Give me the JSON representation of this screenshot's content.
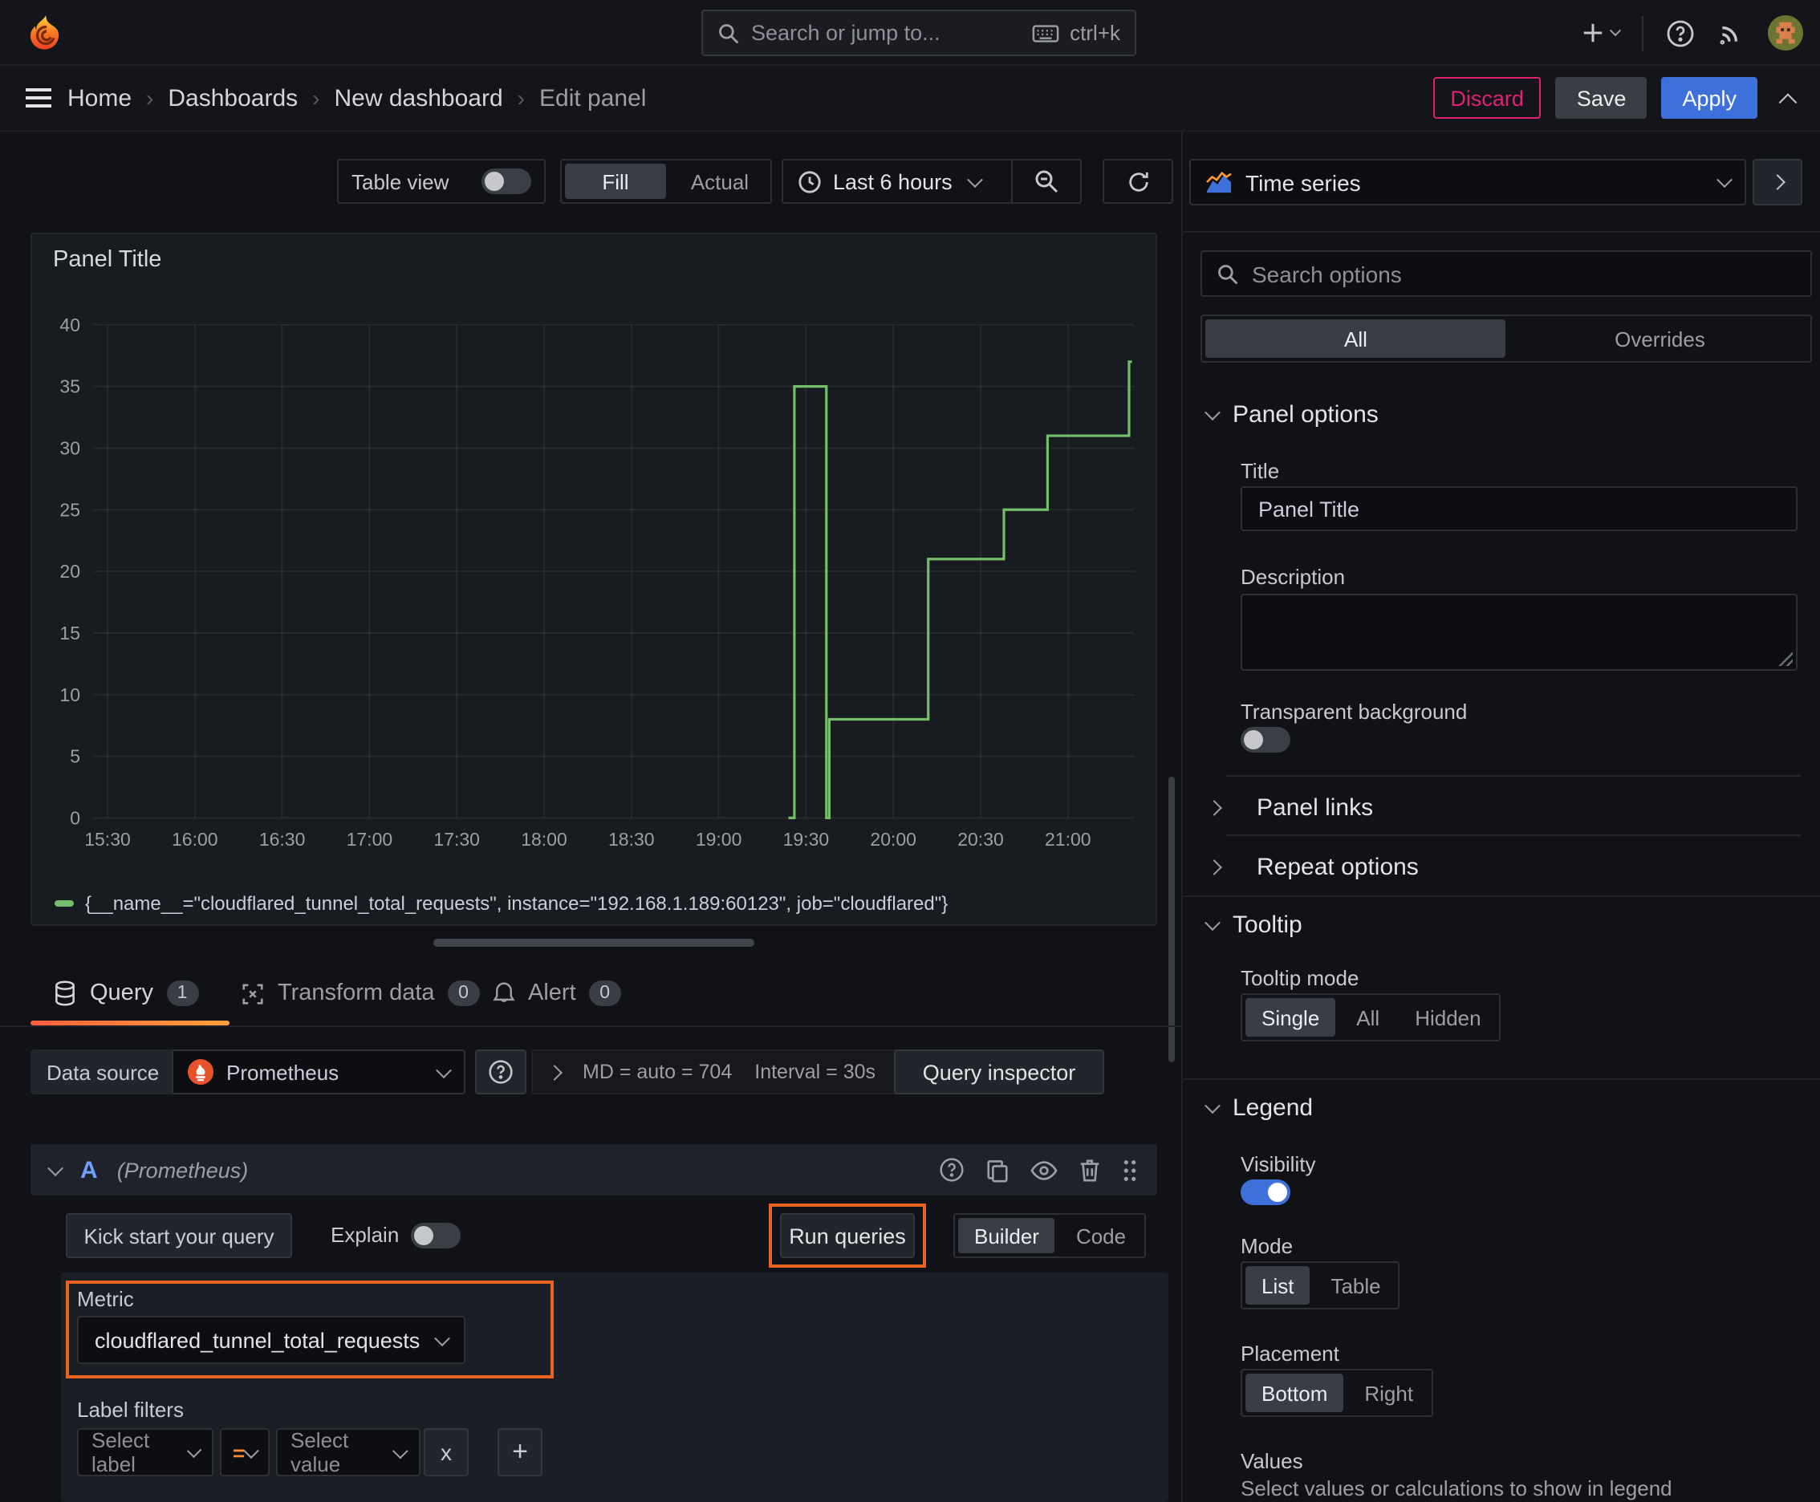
{
  "topbar": {
    "search_placeholder": "Search or jump to...",
    "search_shortcut": "ctrl+k"
  },
  "breadcrumb": {
    "items": [
      "Home",
      "Dashboards",
      "New dashboard",
      "Edit panel"
    ],
    "separator": "›",
    "discard": "Discard",
    "save": "Save",
    "apply": "Apply"
  },
  "toolbar": {
    "table_view": "Table view",
    "fill": "Fill",
    "actual": "Actual",
    "time_range": "Last 6 hours"
  },
  "viz_picker": {
    "type": "Time series",
    "search_placeholder": "Search options",
    "tab_all": "All",
    "tab_overrides": "Overrides"
  },
  "options": {
    "panel_options": {
      "title": "Panel options",
      "title_label": "Title",
      "title_value": "Panel Title",
      "description_label": "Description",
      "transparent_label": "Transparent background",
      "panel_links": "Panel links",
      "repeat_options": "Repeat options"
    },
    "tooltip": {
      "title": "Tooltip",
      "mode_label": "Tooltip mode",
      "modes": [
        "Single",
        "All",
        "Hidden"
      ],
      "selected_mode": "Single"
    },
    "legend": {
      "title": "Legend",
      "visibility_label": "Visibility",
      "visibility_on": true,
      "mode_label": "Mode",
      "modes": [
        "List",
        "Table"
      ],
      "selected_mode": "List",
      "placement_label": "Placement",
      "placements": [
        "Bottom",
        "Right"
      ],
      "selected_placement": "Bottom",
      "values_label": "Values",
      "values_hint": "Select values or calculations to show in legend"
    }
  },
  "panel": {
    "title": "Panel Title"
  },
  "chart_data": {
    "type": "line",
    "title": "Panel Title",
    "style": "step-after",
    "grid": true,
    "legend_position": "bottom",
    "x_ticks": [
      "15:30",
      "16:00",
      "16:30",
      "17:00",
      "17:30",
      "18:00",
      "18:30",
      "19:00",
      "19:30",
      "20:00",
      "20:30",
      "21:00"
    ],
    "y_ticks": [
      0,
      5,
      10,
      15,
      20,
      25,
      30,
      35,
      40
    ],
    "ylim": [
      0,
      40
    ],
    "x_range": [
      "15:30",
      "21:22"
    ],
    "series": [
      {
        "name": "{__name__=\"cloudflared_tunnel_total_requests\", instance=\"192.168.1.189:60123\", job=\"cloudflared\"}",
        "color": "#73bf69",
        "points": [
          [
            "19:24",
            0
          ],
          [
            "19:26",
            35
          ],
          [
            "19:37",
            0
          ],
          [
            "19:38",
            8
          ],
          [
            "20:12",
            21
          ],
          [
            "20:38",
            25
          ],
          [
            "20:53",
            31
          ],
          [
            "21:21",
            37
          ]
        ],
        "end": "21:22"
      }
    ]
  },
  "query_section": {
    "tabs": [
      {
        "label": "Query",
        "count": "1"
      },
      {
        "label": "Transform data",
        "count": "0"
      },
      {
        "label": "Alert",
        "count": "0"
      }
    ],
    "datasource": {
      "label": "Data source",
      "name": "Prometheus",
      "stats": "MD = auto = 704",
      "interval": "Interval = 30s",
      "inspector": "Query inspector"
    },
    "query_row": {
      "ref_id": "A",
      "datasource_hint": "(Prometheus)"
    },
    "actions": {
      "kick_start": "Kick start your query",
      "explain": "Explain",
      "run_queries": "Run queries",
      "builder": "Builder",
      "code": "Code"
    },
    "editor": {
      "metric_label": "Metric",
      "metric_value": "cloudflared_tunnel_total_requests",
      "label_filters_label": "Label filters",
      "select_label_placeholder": "Select label",
      "operator": "=",
      "select_value_placeholder": "Select value",
      "remove": "x",
      "add": "+"
    }
  },
  "colors": {
    "background": "#111217",
    "panel_background": "#181b1f",
    "series_green": "#73bf69",
    "accent_blue": "#3d71d9",
    "annotation_orange": "#e96323",
    "tab_underline_gradient": [
      "#ff5f3c",
      "#ffa13c"
    ],
    "discard_pink": "#e0226e",
    "operator_orange": "#ff8833"
  }
}
